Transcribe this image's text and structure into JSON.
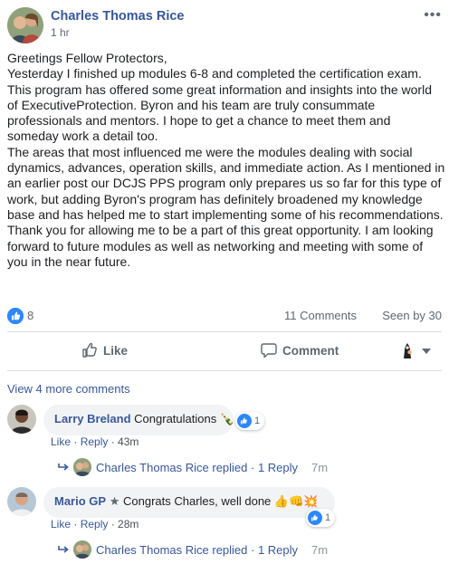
{
  "post": {
    "author": "Charles Thomas Rice",
    "time": "1 hr",
    "more_label": "•••",
    "paragraphs": [
      "Greetings Fellow Protectors,",
      "Yesterday I finished up modules 6-8 and completed the certification exam. This program has offered some great information and insights into the world of ExecutiveProtection. Byron and his team are truly consummate professionals and mentors. I hope to get a chance to meet them and someday work a detail too.",
      "The areas that most influenced me were the modules dealing with social dynamics, advances, operation skills, and immediate action. As I mentioned in an earlier post our DCJS PPS program only prepares us so far for this type of work, but adding Byron's program has definitely broadened my knowledge base and has helped me to start implementing some of his recommendations. Thank you for allowing me to be a part of this great opportunity. I am looking forward to future modules as well as networking and meeting with some of you in the near future."
    ]
  },
  "stats": {
    "likes": "8",
    "comments": "11 Comments",
    "seen_by": "Seen by 30"
  },
  "actions": {
    "like": "Like",
    "comment": "Comment"
  },
  "view_more_comments": "View 4 more comments",
  "comments": [
    {
      "author": "Larry Breland",
      "text": "Congratulations 🍾",
      "reaction_count": "1",
      "like_label": "Like",
      "reply_label": "Reply",
      "age": "43m",
      "reply": {
        "text": "Charles Thomas Rice replied · 1 Reply",
        "age": "7m"
      }
    },
    {
      "author": "Mario GP",
      "badge": "★",
      "text": "Congrats Charles, well done 👍👊💥",
      "reaction_count": "1",
      "like_label": "Like",
      "reply_label": "Reply",
      "age": "28m",
      "reply": {
        "text": "Charles Thomas Rice replied · 1 Reply",
        "age": "7m"
      }
    }
  ],
  "colors": {
    "link": "#385898",
    "author": "#365899",
    "like_blue": "#2d88ff",
    "bubble_bg": "#f2f3f5",
    "muted": "#606770"
  },
  "icons": {
    "like_action": "thumbs-up-outline-icon",
    "comment_action": "speech-bubble-icon",
    "like_reaction": "like-reaction-icon",
    "reply_arrow": "reply-arrow-icon",
    "share_selector": "page-avatar-selector-icon"
  }
}
